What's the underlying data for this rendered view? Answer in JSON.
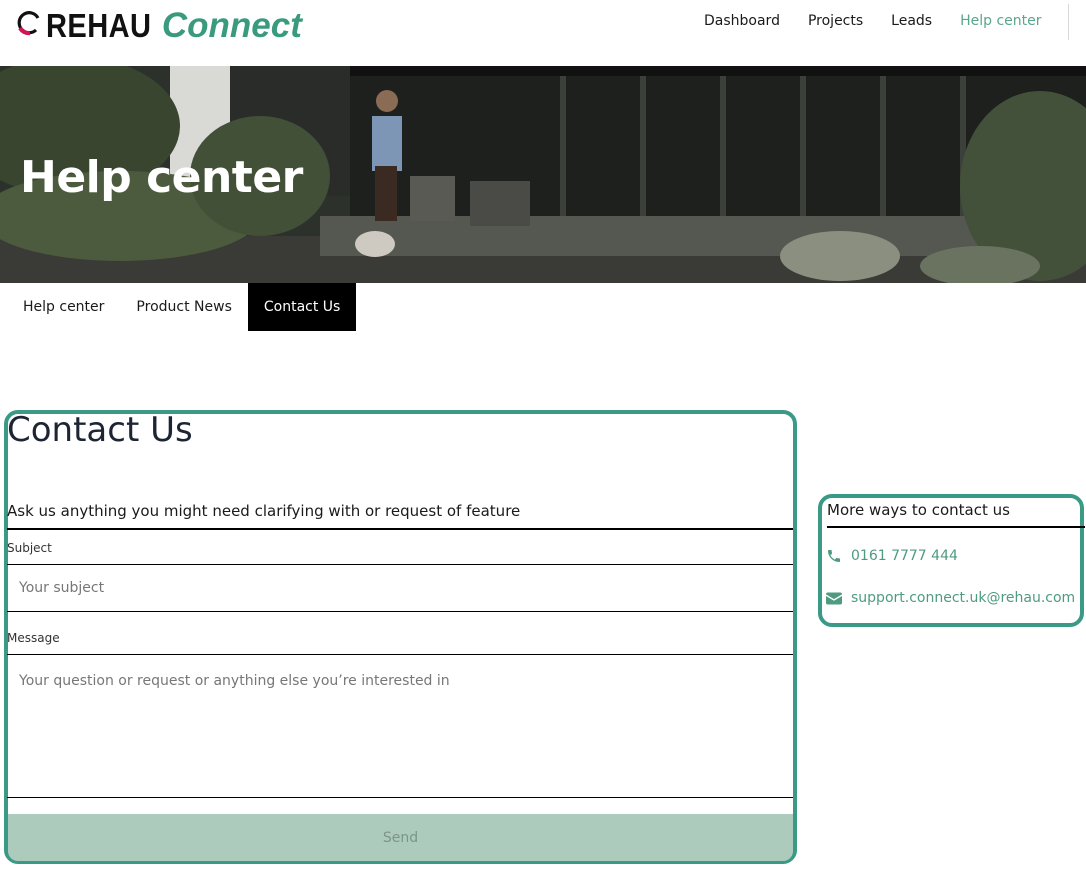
{
  "brand": {
    "name_part1": "REHAU",
    "name_part2": "Connect"
  },
  "nav": {
    "items": [
      {
        "label": "Dashboard"
      },
      {
        "label": "Projects"
      },
      {
        "label": "Leads"
      },
      {
        "label": "Help center",
        "active": true
      }
    ]
  },
  "hero": {
    "title": "Help center"
  },
  "tabs": [
    {
      "label": "Help center"
    },
    {
      "label": "Product News"
    },
    {
      "label": "Contact Us",
      "active": true
    }
  ],
  "contact_form": {
    "title": "Contact Us",
    "description": "Ask us anything you might need clarifying with or request of feature",
    "subject_label": "Subject",
    "subject_placeholder": "Your subject",
    "message_label": "Message",
    "message_placeholder": "Your question or request or anything else you’re interested in",
    "send_label": "Send"
  },
  "more_ways": {
    "title": "More ways to contact us",
    "phone": "0161 7777 444",
    "email": "support.connect.uk@rehau.com",
    "phone_icon": "phone-icon",
    "email_icon": "envelope-icon"
  },
  "colors": {
    "accent": "#3a9a7e",
    "link": "#4f9b80",
    "highlight_border": "#3a9a86",
    "send_button": "#adcbbd",
    "active_tab": "#000000"
  }
}
